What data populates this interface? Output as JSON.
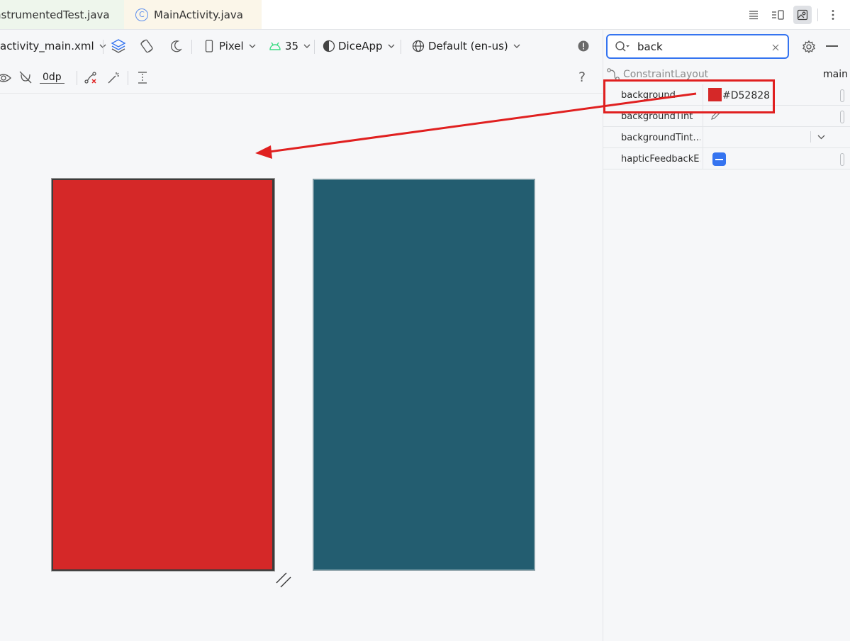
{
  "tabs": [
    {
      "label": "nstrumentedTest.java",
      "active": false
    },
    {
      "label": "MainActivity.java",
      "active": false,
      "icon": "class-c-icon"
    }
  ],
  "toolbar": {
    "file": "activity_main.xml",
    "device": "Pixel",
    "api_level": "35",
    "theme": "DiceApp",
    "locale": "Default (en-us)"
  },
  "toolbar2": {
    "margin": "0dp",
    "help": "?"
  },
  "search": {
    "value": "back",
    "placeholder": ""
  },
  "attributes": {
    "component": "ConstraintLayout",
    "id": "main",
    "rows": [
      {
        "name": "background",
        "value": "#D52828",
        "swatch": "#d52828"
      },
      {
        "name": "backgroundTint",
        "value": ""
      },
      {
        "name": "backgroundTint…",
        "value": ""
      },
      {
        "name": "hapticFeedbackE…",
        "value": ""
      }
    ]
  },
  "colors": {
    "accent": "#3574f0",
    "highlight": "#e02020",
    "design_background": "#d52828",
    "blueprint_background": "#235d70"
  }
}
